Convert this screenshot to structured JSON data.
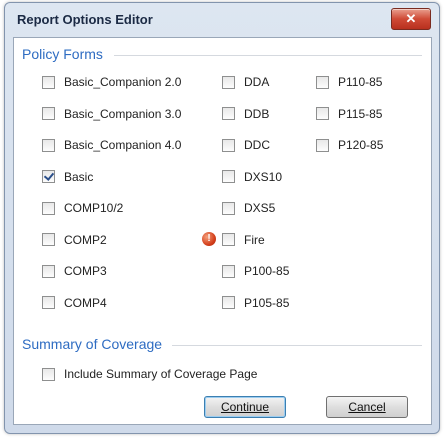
{
  "window": {
    "title": "Report Options Editor",
    "close_glyph": "✕"
  },
  "policy_forms": {
    "heading": "Policy Forms",
    "columns": [
      [
        {
          "label": "Basic_Companion 2.0",
          "checked": false
        },
        {
          "label": "Basic_Companion 3.0",
          "checked": false
        },
        {
          "label": "Basic_Companion 4.0",
          "checked": false
        },
        {
          "label": "Basic",
          "checked": true
        },
        {
          "label": "COMP10/2",
          "checked": false
        },
        {
          "label": "COMP2",
          "checked": false
        },
        {
          "label": "COMP3",
          "checked": false
        },
        {
          "label": "COMP4",
          "checked": false
        }
      ],
      [
        {
          "label": "DDA",
          "checked": false
        },
        {
          "label": "DDB",
          "checked": false
        },
        {
          "label": "DDC",
          "checked": false
        },
        {
          "label": "DXS10",
          "checked": false
        },
        {
          "label": "DXS5",
          "checked": false
        },
        {
          "label": "Fire",
          "checked": false,
          "warning": true
        },
        {
          "label": "P100-85",
          "checked": false
        },
        {
          "label": "P105-85",
          "checked": false
        }
      ],
      [
        {
          "label": "P110-85",
          "checked": false
        },
        {
          "label": "P115-85",
          "checked": false
        },
        {
          "label": "P120-85",
          "checked": false
        }
      ]
    ]
  },
  "summary": {
    "heading": "Summary of Coverage",
    "include_label": "Include Summary of Coverage Page",
    "include_checked": false
  },
  "buttons": {
    "continue_label": "Continue",
    "cancel_label": "Cancel"
  },
  "icons": {
    "warning": "warning-icon",
    "warning_glyph": "!"
  }
}
